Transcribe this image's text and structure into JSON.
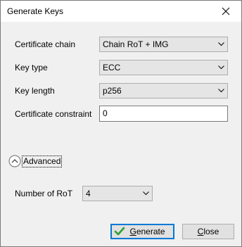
{
  "window": {
    "title": "Generate Keys",
    "close_glyph": "close-icon"
  },
  "form": {
    "certificate_chain": {
      "label": "Certificate chain",
      "value": "Chain RoT + IMG"
    },
    "key_type": {
      "label": "Key type",
      "value": "ECC"
    },
    "key_length": {
      "label": "Key length",
      "value": "p256"
    },
    "certificate_constraint": {
      "label": "Certificate constraint",
      "value": "0"
    }
  },
  "advanced": {
    "label": "Advanced",
    "icon": "chevron-up-circle-icon",
    "number_of_rot": {
      "label": "Number of RoT",
      "value": "4"
    }
  },
  "buttons": {
    "generate": {
      "prefix": "",
      "mnemonic": "G",
      "rest": "enerate",
      "icon": "checkmark-icon",
      "icon_color": "#2e9e2e"
    },
    "close": {
      "prefix": "",
      "mnemonic": "C",
      "rest": "lose"
    }
  },
  "colors": {
    "focus_border": "#0078d7",
    "dialog_bg": "#f0f0f0"
  }
}
